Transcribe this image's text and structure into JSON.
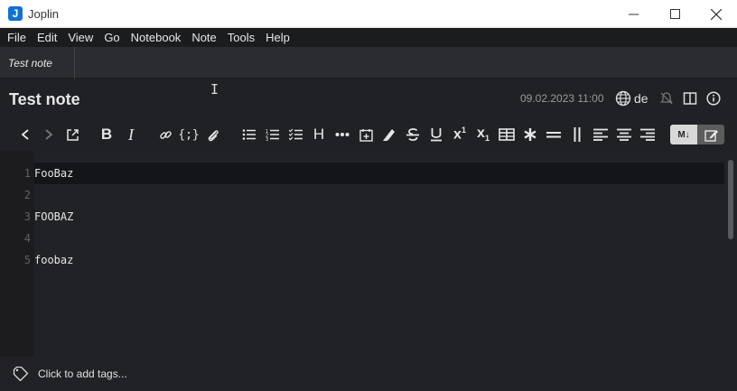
{
  "window": {
    "title": "Joplin",
    "app_icon_letter": "J"
  },
  "menu": [
    "File",
    "Edit",
    "View",
    "Go",
    "Notebook",
    "Note",
    "Tools",
    "Help"
  ],
  "tabs": [
    {
      "label": "Test note"
    }
  ],
  "note": {
    "title": "Test note",
    "date": "09.02.2023 11:00",
    "language": "de"
  },
  "toolbar": {
    "toggle_md_label": "M↓"
  },
  "editor": {
    "line_numbers": [
      "1",
      "2",
      "3",
      "4",
      "5"
    ],
    "lines": [
      "FooBaz",
      "",
      "FOOBAZ",
      "",
      "foobaz"
    ]
  },
  "footer": {
    "tags_placeholder": "Click to add tags..."
  },
  "colors": {
    "accent": "#1071d3",
    "background": "#212226",
    "menu_bg": "#1b1c1e"
  }
}
